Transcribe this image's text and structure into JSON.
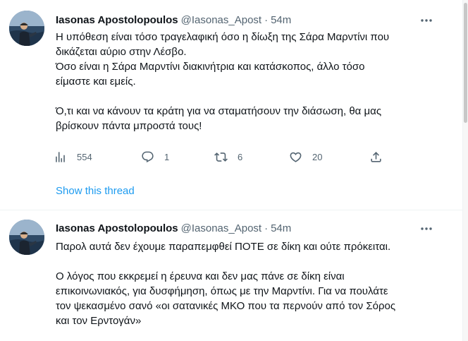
{
  "tweets": [
    {
      "author_name": "Iasonas Apostolopoulos",
      "handle": "@Iasonas_Apost",
      "separator": "·",
      "time": "54m",
      "more_icon": "more-horizontal-icon",
      "text_lines": [
        "Η υπόθεση είναι τόσο τραγελαφική όσο η δίωξη της Σάρα Μαρντίνι που",
        "δικάζεται αύριο στην Λέσβο.",
        "Όσο είναι η Σάρα Μαρντίνι διακινήτρια και κατάσκοπος, άλλο τόσο",
        "είμαστε και εμείς.",
        "",
        "Ό,τι και να κάνουν τα κράτη για να σταματήσουν την διάσωση, θα μας",
        "βρίσκουν πάντα μπροστά τους!"
      ],
      "actions": {
        "views": "554",
        "replies": "1",
        "retweets": "6",
        "likes": "20"
      },
      "show_thread": "Show this thread"
    },
    {
      "author_name": "Iasonas Apostolopoulos",
      "handle": "@Iasonas_Apost",
      "separator": "·",
      "time": "54m",
      "more_icon": "more-horizontal-icon",
      "text_lines": [
        "Παρολ αυτά δεν έχουμε παραπεμφθεί ΠΟΤΕ σε δίκη και ούτε πρόκειται.",
        "",
        "Ο λόγος που εκκρεμεί η έρευνα και δεν μας πάνε σε δίκη είναι",
        "επικοινωνιακός, για δυσφήμηση, όπως με την Μαρντίνι. Για να πουλάτε",
        "τον ψεκασμένο σανό «οι σατανικές ΜΚΟ που τα περνούν από τον Σόρος",
        "και τον Ερντογάν»"
      ]
    }
  ],
  "colors": {
    "text_primary": "#0f1419",
    "text_secondary": "#536471",
    "link": "#1d9bf0",
    "divider": "#eff3f4"
  }
}
